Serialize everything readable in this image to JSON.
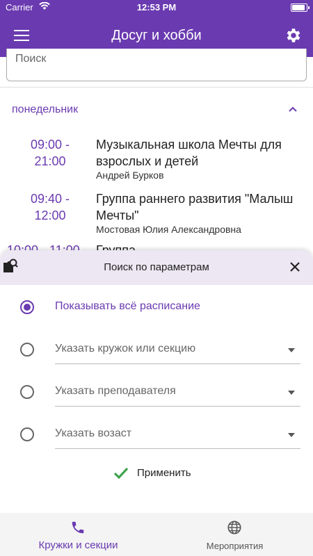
{
  "status_bar": {
    "carrier": "Carrier",
    "time": "12:53 PM"
  },
  "app_bar": {
    "title": "Досуг и хобби"
  },
  "search": {
    "placeholder": "Поиск"
  },
  "schedule": {
    "day": "понедельник",
    "items": [
      {
        "time": "09:00 - 21:00",
        "title": "Музыкальная школа Мечты для взрослых и детей",
        "person": "Андрей Бурков"
      },
      {
        "time": "09:40 - 12:00",
        "title": "Группа раннего развития \"Малыш Мечты\"",
        "person": "Мостовая Юлия Александровна"
      },
      {
        "time": "10:00 - 11:00",
        "title": "Группа"
      }
    ]
  },
  "filter_sheet": {
    "title": "Поиск по параметрам",
    "options": [
      {
        "label": "Показывать всё расписание",
        "selected": true
      },
      {
        "label": "Указать кружок или секцию",
        "selected": false
      },
      {
        "label": "Указать преподавателя",
        "selected": false
      },
      {
        "label": "Указать возаст",
        "selected": false
      }
    ],
    "apply_label": "Применить"
  },
  "bottom_nav": {
    "items": [
      {
        "label": "Кружки и секции",
        "icon": "phone-icon",
        "active": true
      },
      {
        "label": "Мероприятия",
        "icon": "globe-icon",
        "active": false
      }
    ]
  },
  "colors": {
    "primary": "#6a3ab0",
    "sheet_header": "#ece7f2",
    "check": "#3fa34d"
  }
}
